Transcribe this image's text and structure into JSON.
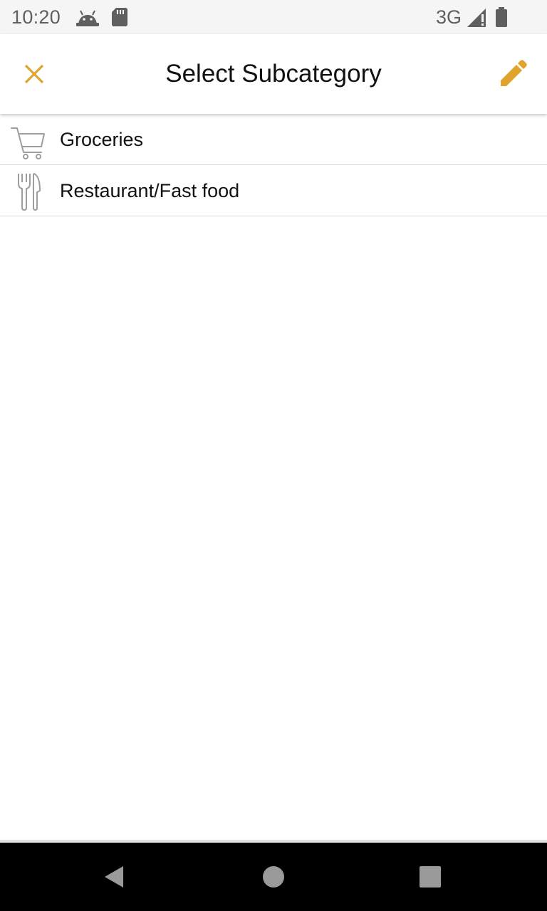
{
  "status_bar": {
    "time": "10:20",
    "network": "3G",
    "icons": [
      "android-debug-icon",
      "sd-card-icon",
      "signal-icon",
      "battery-icon"
    ]
  },
  "app_bar": {
    "title": "Select Subcategory",
    "close_icon": "close-icon",
    "edit_icon": "pencil-icon",
    "accent_color": "#E0A32E"
  },
  "subcategories": [
    {
      "label": "Groceries",
      "icon": "shopping-cart-icon"
    },
    {
      "label": "Restaurant/Fast food",
      "icon": "fork-knife-icon"
    }
  ],
  "nav_bar": {
    "icons": [
      "back-icon",
      "home-icon",
      "recents-icon"
    ]
  }
}
